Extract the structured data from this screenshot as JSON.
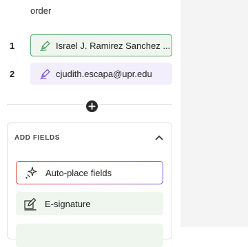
{
  "sidebar": {
    "order_label": "order",
    "signers": [
      {
        "number": "1",
        "label": "Israel J. Ramirez Sanchez ...",
        "color": "#5aa866"
      },
      {
        "number": "2",
        "label": "cjudith.escapa@upr.edu",
        "color": "#7b4fd1"
      }
    ],
    "add_recipient_icon": "plus-circle-icon"
  },
  "add_fields": {
    "title": "ADD FIELDS",
    "collapse_icon": "chevron-up-icon",
    "items": [
      {
        "label": "Auto-place fields",
        "icon": "sparkle-icon"
      },
      {
        "label": "E-signature",
        "icon": "signature-icon"
      }
    ]
  }
}
